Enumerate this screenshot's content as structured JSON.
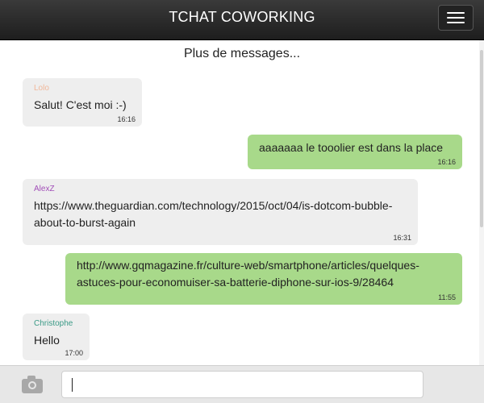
{
  "header": {
    "title": "TCHAT COWORKING",
    "menu_icon": "hamburger-menu-icon"
  },
  "messages_area": {
    "load_more_label": "Plus de messages..."
  },
  "messages": [
    {
      "direction": "incoming",
      "author": "Lolo",
      "author_color": "#f0b79a",
      "text": "Salut! C'est moi :-)",
      "time": "16:16"
    },
    {
      "direction": "outgoing",
      "author": "",
      "text": "aaaaaaa le tooolier est dans la place",
      "time": "16:16"
    },
    {
      "direction": "incoming",
      "author": "AlexZ",
      "author_color": "#a24fb8",
      "text": "https://www.theguardian.com/technology/2015/oct/04/is-dotcom-bubble-about-to-burst-again",
      "time": "16:31"
    },
    {
      "direction": "outgoing",
      "author": "",
      "text": "http://www.gqmagazine.fr/culture-web/smartphone/articles/quelques-astuces-pour-economuiser-sa-batterie-diphone-sur-ios-9/28464",
      "time": "11:55"
    },
    {
      "direction": "incoming",
      "author": "Christophe",
      "author_color": "#3a9a86",
      "text": "Hello",
      "time": "17:00"
    }
  ],
  "input_bar": {
    "camera_icon": "camera-icon",
    "input_value": "",
    "input_placeholder": ""
  },
  "colors": {
    "header_bg": "#2b2b2b",
    "incoming_bubble": "#eeeeee",
    "outgoing_bubble": "#a8d98a",
    "input_bar_bg": "#e7e7e7"
  }
}
